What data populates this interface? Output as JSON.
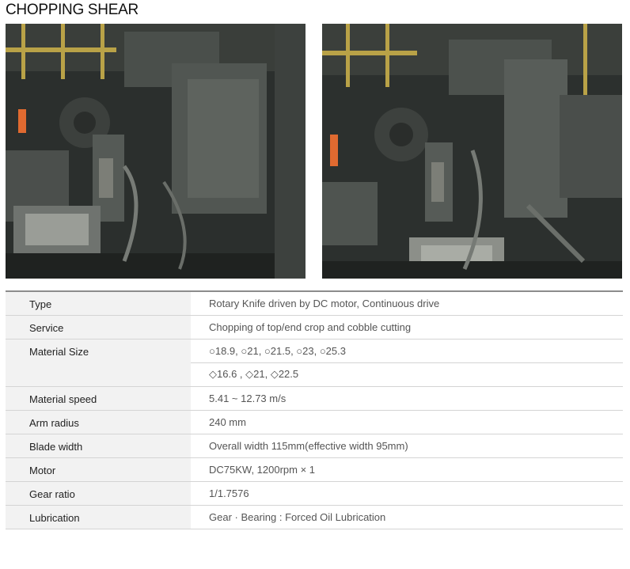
{
  "page": {
    "title": "CHOPPING SHEAR"
  },
  "photos": [
    {
      "alt": "chopping shear machine photo"
    },
    {
      "alt": "chopping shear machine photo"
    }
  ],
  "specs": [
    {
      "label": "Type",
      "values": [
        "Rotary Knife driven by DC motor, Continuous drive"
      ]
    },
    {
      "label": "Service",
      "values": [
        "Chopping of top/end crop and cobble cutting"
      ]
    },
    {
      "label": "Material Size",
      "values": [
        "○18.9, ○21, ○21.5, ○23, ○25.3",
        "◇16.6 , ◇21, ◇22.5"
      ]
    },
    {
      "label": "Material speed",
      "values": [
        "5.41 ~ 12.73 m/s"
      ]
    },
    {
      "label": "Arm radius",
      "values": [
        "240 mm"
      ]
    },
    {
      "label": "Blade width",
      "values": [
        "Overall width 115mm(effective width 95mm)"
      ]
    },
    {
      "label": "Motor",
      "values": [
        "DC75KW, 1200rpm × 1"
      ]
    },
    {
      "label": "Gear ratio",
      "values": [
        "1/1.7576"
      ]
    },
    {
      "label": "Lubrication",
      "values": [
        "Gear · Bearing : Forced Oil Lubrication"
      ]
    }
  ]
}
